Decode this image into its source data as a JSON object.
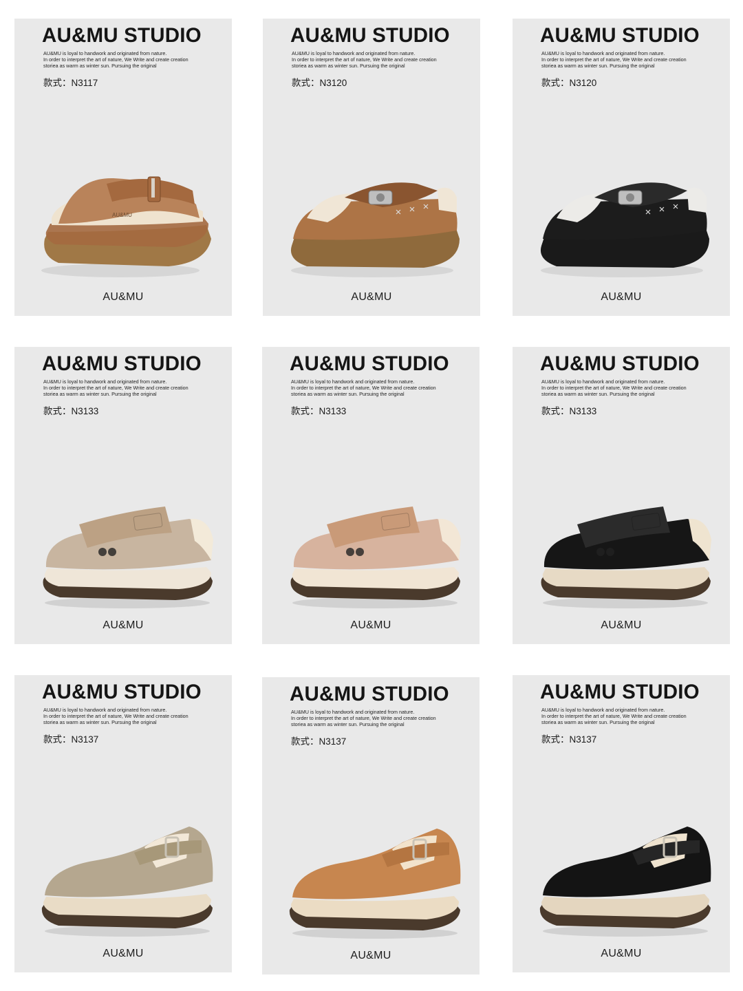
{
  "cards": [
    {
      "brand": "AU&MU STUDIO",
      "desc1": "AU&MU is loyal to handwork and originated from nature.",
      "desc2": "In order to interpret the art of nature, We Write and create creation",
      "desc3": "storiea as warm as winter sun. Pursuing the original",
      "style": "款式：N3117",
      "logo": "AU&MU",
      "shoe": "sandal-slide",
      "upper": "#b9835a",
      "accent": "#a4693f",
      "sole": "#a07846",
      "fur": "#efe3cf"
    },
    {
      "brand": "AU&MU STUDIO",
      "desc1": "AU&MU is loyal to handwork and originated from nature.",
      "desc2": "In order to interpret the art of nature, We Write and create creation",
      "desc3": "storiea as warm as winter sun. Pursuing the original",
      "style": "款式：N3120",
      "logo": "AU&MU",
      "shoe": "buckle-mule",
      "upper": "#ad7446",
      "accent": "#8a5530",
      "sole": "#8f6a3c",
      "fur": "#f0e6d6"
    },
    {
      "brand": "AU&MU STUDIO",
      "desc1": "AU&MU is loyal to handwork and originated from nature.",
      "desc2": "In order to interpret the art of nature, We Write and create creation",
      "desc3": "storiea as warm as winter sun. Pursuing the original",
      "style": "款式：N3120",
      "logo": "AU&MU",
      "shoe": "buckle-mule",
      "upper": "#1c1c1c",
      "accent": "#2a2a2a",
      "sole": "#1a1a1a",
      "fur": "#ecebe8"
    },
    {
      "brand": "AU&MU STUDIO",
      "desc1": "AU&MU is loyal to handwork and originated from nature.",
      "desc2": "In order to interpret the art of nature, We Write and create creation",
      "desc3": "storiea as warm as winter sun. Pursuing the original",
      "style": "款式：N3133",
      "logo": "AU&MU",
      "shoe": "strap-clog",
      "upper": "#c8b5a0",
      "accent": "#bca184",
      "sole": "#efe6d8",
      "fur": "#f3ead9"
    },
    {
      "brand": "AU&MU STUDIO",
      "desc1": "AU&MU is loyal to handwork and originated from nature.",
      "desc2": "In order to interpret the art of nature, We Write and create creation",
      "desc3": "storiea as warm as winter sun. Pursuing the original",
      "style": "款式：N3133",
      "logo": "AU&MU",
      "shoe": "strap-clog",
      "upper": "#d7b39e",
      "accent": "#c99a78",
      "sole": "#f1e5d4",
      "fur": "#f3e7d6"
    },
    {
      "brand": "AU&MU STUDIO",
      "desc1": "AU&MU is loyal to handwork and originated from nature.",
      "desc2": "In order to interpret the art of nature, We Write and create creation",
      "desc3": "storiea as warm as winter sun. Pursuing the original",
      "style": "款式：N3133",
      "logo": "AU&MU",
      "shoe": "strap-clog",
      "upper": "#161616",
      "accent": "#2b2b2b",
      "sole": "#e7dac5",
      "fur": "#efe4d0"
    },
    {
      "brand": "AU&MU STUDIO",
      "desc1": "AU&MU is loyal to handwork and originated from nature.",
      "desc2": "In order to interpret the art of nature, We Write and create creation",
      "desc3": "storiea as warm as winter sun. Pursuing the original",
      "style": "款式：N3137",
      "logo": "AU&MU",
      "shoe": "buckle-clog",
      "upper": "#b5a78f",
      "accent": "#a79879",
      "sole": "#e9dcc6",
      "fur": "#f2e8d8"
    },
    {
      "brand": "AU&MU STUDIO",
      "desc1": "AU&MU is loyal to handwork and originated from nature.",
      "desc2": "In order to interpret the art of nature, We Write and create creation",
      "desc3": "storiea as warm as winter sun. Pursuing the original",
      "style": "款式：N3137",
      "logo": "AU&MU",
      "shoe": "buckle-clog",
      "upper": "#c7864f",
      "accent": "#b47541",
      "sole": "#ebdcc4",
      "fur": "#f2e3cc"
    },
    {
      "brand": "AU&MU STUDIO",
      "desc1": "AU&MU is loyal to handwork and originated from nature.",
      "desc2": "In order to interpret the art of nature, We Write and create creation",
      "desc3": "storiea as warm as winter sun. Pursuing the original",
      "style": "款式：N3137",
      "logo": "AU&MU",
      "shoe": "buckle-clog",
      "upper": "#141414",
      "accent": "#262626",
      "sole": "#e4d6bf",
      "fur": "#efe3cf"
    }
  ]
}
